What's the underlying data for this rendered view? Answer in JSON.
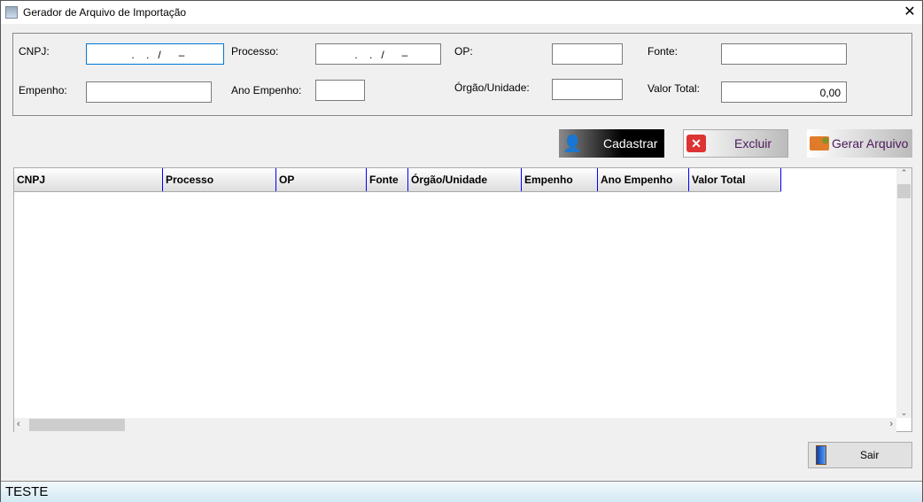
{
  "window": {
    "title": "Gerador de Arquivo de Importação",
    "close": "✕"
  },
  "form": {
    "cnpj_label": "CNPJ:",
    "cnpj_mask": "  .    .   /      –",
    "processo_label": "Processo:",
    "processo_mask": "  .    .   /      –",
    "op_label": "OP:",
    "fonte_label": "Fonte:",
    "empenho_label": "Empenho:",
    "ano_empenho_label": "Ano Empenho:",
    "orgao_label": "Órgão/Unidade:",
    "valor_total_label": "Valor Total:",
    "valor_total_value": "0,00"
  },
  "actions": {
    "cadastrar": "Cadastrar",
    "excluir": "Excluir",
    "gerar": "Gerar Arquivo",
    "sair": "Sair"
  },
  "table": {
    "columns": [
      "CNPJ",
      "Processo",
      "OP",
      "Fonte",
      "Órgão/Unidade",
      "Empenho",
      "Ano Empenho",
      "Valor Total"
    ],
    "rows": []
  },
  "status": {
    "text": "TESTE"
  }
}
